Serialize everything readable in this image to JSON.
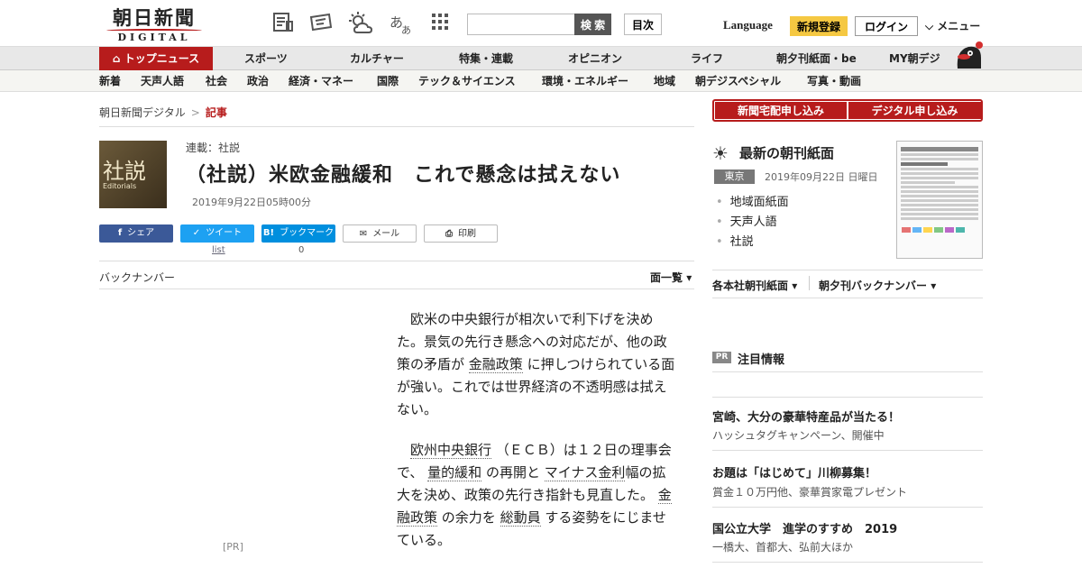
{
  "header": {
    "logo_ja": "朝日新聞",
    "logo_en": "DIGITAL",
    "search_button": "検 索",
    "search_placeholder": "",
    "toc_button": "目次",
    "language": "Language",
    "register": "新規登録",
    "login": "ログイン",
    "menu": "メニュー"
  },
  "nav_main": [
    "トップニュース",
    "スポーツ",
    "カルチャー",
    "特集・連載",
    "オピニオン",
    "ライフ",
    "朝夕刊紙面・be",
    "MY朝デジ"
  ],
  "nav_sub": [
    "新着",
    "天声人語",
    "社会",
    "政治",
    "経済・マネー",
    "国際",
    "テック＆サイエンス",
    "環境・エネルギー",
    "地域",
    "朝デジスペシャル",
    "写真・動画"
  ],
  "breadcrumb": {
    "home": "朝日新聞デジタル",
    "sep": ">",
    "current": "記事"
  },
  "article": {
    "kanban_ja": "社説",
    "kanban_en": "Editorials",
    "series": "連載：社説",
    "title": "（社説）米欧金融緩和　これで懸念は拭えない",
    "date": "2019年9月22日05時00分",
    "share": {
      "facebook": "シェア",
      "twitter": "ツイート",
      "twitter_sub": "list",
      "hatena": "ブックマーク",
      "hatena_sub": "0",
      "mail": "メール",
      "print": "印刷"
    },
    "back_numbers": "バックナンバー",
    "page_list": "面一覧",
    "pr": "[PR]",
    "paragraphs": [
      [
        {
          "t": "欧米の中央銀行が相次いで利下げを決めた。景気の先行き懸念への対応だが、他の政策の矛盾が "
        },
        {
          "t": "金融政策",
          "u": true
        },
        {
          "t": " に押しつけられている面が強い。これでは世界経済の不透明感は拭えない。"
        }
      ],
      [
        {
          "t": "欧州中央銀行",
          "u": true
        },
        {
          "t": " （ＥＣＢ）は１２日の理事会で、 "
        },
        {
          "t": "量的緩和",
          "u": true
        },
        {
          "t": " の再開と "
        },
        {
          "t": "マイナス金利",
          "u": true
        },
        {
          "t": "幅の拡大を決め、政策の先行き指針も見直した。 "
        },
        {
          "t": "金融政策",
          "u": true
        },
        {
          "t": " の余力を "
        },
        {
          "t": "総動員",
          "u": true
        },
        {
          "t": " する姿勢をにじませている。"
        }
      ]
    ]
  },
  "sidebar": {
    "subscribe_paper": "新聞宅配申し込み",
    "subscribe_digital": "デジタル申し込み",
    "latest_title": "最新の朝刊紙面",
    "region": "東京",
    "date": "2019年09月22日 日曜日",
    "links": [
      "地域面紙面",
      "天声人語",
      "社説"
    ],
    "paper_links": [
      "各本社朝刊紙面",
      "朝夕刊バックナンバー"
    ],
    "pr_tag": "PR",
    "attention": "注目情報",
    "ads": [
      {
        "title": "宮崎、大分の豪華特産品が当たる！",
        "sub": "ハッシュタグキャンペーン、開催中"
      },
      {
        "title": "お題は「はじめて」川柳募集！",
        "sub": "賞金１０万円他、豪華賞家電プレゼント"
      },
      {
        "title": "国公立大学　進学のすすめ　2019",
        "sub": "一橋大、首都大、弘前大ほか"
      }
    ]
  },
  "colors": {
    "accent": "#b71c1c",
    "register": "#f5c842",
    "facebook": "#3b5998",
    "twitter": "#1da1f2",
    "hatena": "#008fde"
  }
}
